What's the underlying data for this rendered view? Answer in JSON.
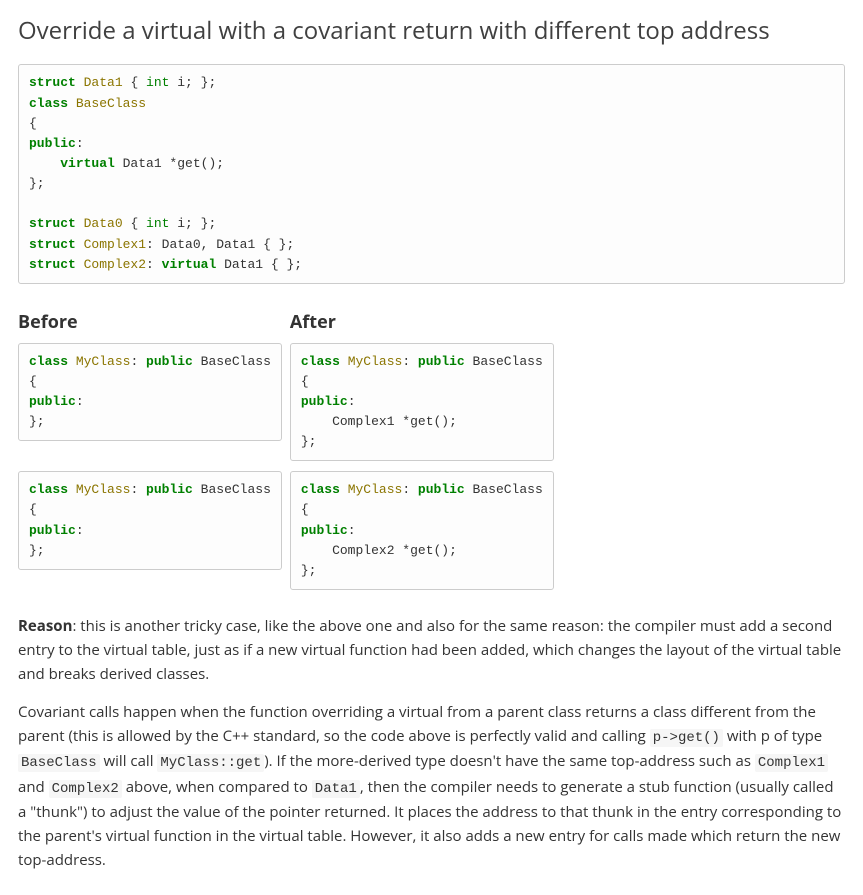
{
  "title": "Override a virtual with a covariant return with different top address",
  "code_top_html": "<span class=\"kw\">struct</span> <span class=\"ty\">Data1</span> { <span class=\"kwbi\">int</span> i; };\n<span class=\"kw\">class</span> <span class=\"ty\">BaseClass</span>\n{\n<span class=\"kw\">public</span>:\n    <span class=\"kw\">virtual</span> Data1 *get();\n};\n\n<span class=\"kw\">struct</span> <span class=\"ty\">Data0</span> { <span class=\"kwbi\">int</span> i; };\n<span class=\"kw\">struct</span> <span class=\"ty\">Complex1</span>: Data0, Data1 { };\n<span class=\"kw\">struct</span> <span class=\"ty\">Complex2</span>: <span class=\"kw\">virtual</span> Data1 { };",
  "before_label": "Before",
  "after_label": "After",
  "before1_html": "<span class=\"kw\">class</span> <span class=\"ty\">MyClass</span>: <span class=\"kw\">public</span> BaseClass\n{\n<span class=\"kw\">public</span>:\n};",
  "after1_html": "<span class=\"kw\">class</span> <span class=\"ty\">MyClass</span>: <span class=\"kw\">public</span> BaseClass\n{\n<span class=\"kw\">public</span>:\n    Complex1 *get();\n};",
  "before2_html": "<span class=\"kw\">class</span> <span class=\"ty\">MyClass</span>: <span class=\"kw\">public</span> BaseClass\n{\n<span class=\"kw\">public</span>:\n};",
  "after2_html": "<span class=\"kw\">class</span> <span class=\"ty\">MyClass</span>: <span class=\"kw\">public</span> BaseClass\n{\n<span class=\"kw\">public</span>:\n    Complex2 *get();\n};",
  "reason_label": "Reason",
  "reason_text": ": this is another tricky case, like the above one and also for the same reason: the compiler must add a second entry to the virtual table, just as if a new virtual function had been added, which changes the layout of the virtual table and breaks derived classes.",
  "para2_pre": "Covariant calls happen when the function overriding a virtual from a parent class returns a class different from the parent (this is allowed by the C++ standard, so the code above is perfectly valid and calling ",
  "para2_c1": "p->get()",
  "para2_mid1": " with p of type ",
  "para2_c2": "BaseClass",
  "para2_mid2": " will call ",
  "para2_c3": "MyClass::get",
  "para2_mid3": "). If the more-derived type doesn't have the same top-address such as ",
  "para2_c4": "Complex1",
  "para2_mid4": " and ",
  "para2_c5": "Complex2",
  "para2_mid5": " above, when compared to ",
  "para2_c6": "Data1",
  "para2_post": ", then the compiler needs to generate a stub function (usually called a \"thunk\") to adjust the value of the pointer returned. It places the address to that thunk in the entry corresponding to the parent's virtual function in the virtual table. However, it also adds a new entry for calls made which return the new top-address."
}
